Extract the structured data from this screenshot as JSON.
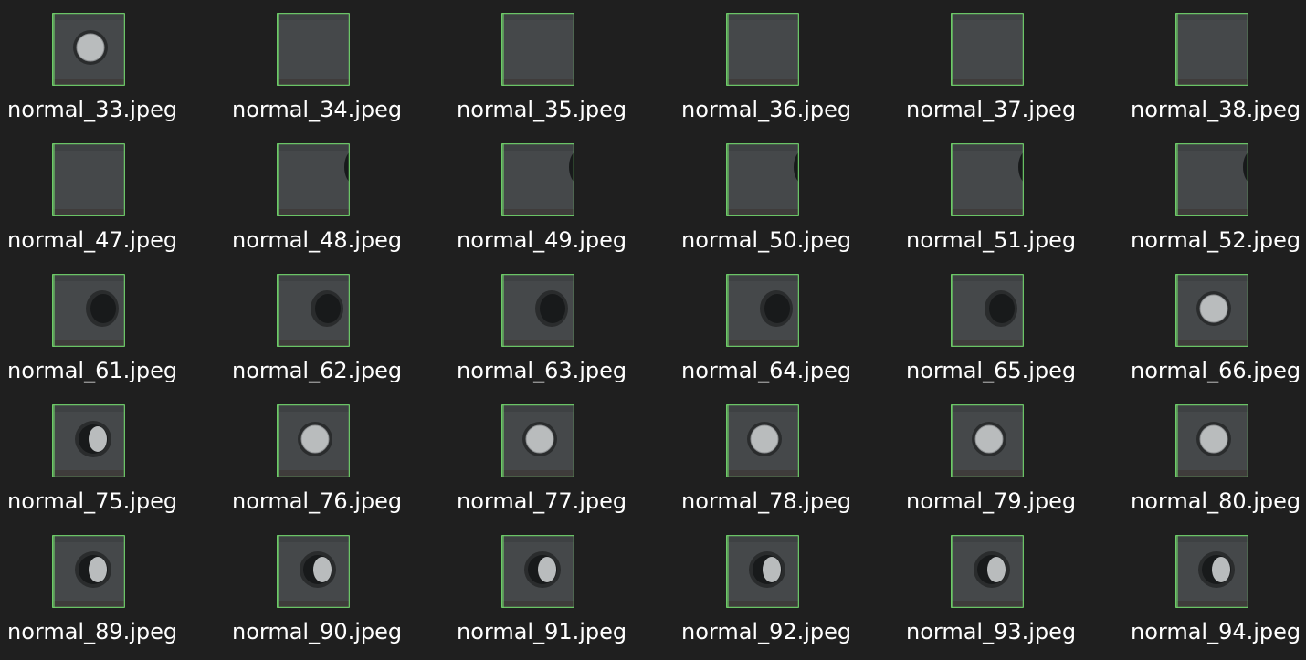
{
  "colors": {
    "background": "#1f1f1f",
    "label": "#ffffff",
    "thumb_border": "#6fd26a",
    "panel": "#45484a",
    "hole_dark": "#181a1b",
    "hole_light": "#b9bcbd"
  },
  "files": [
    {
      "name": "normal_33.jpeg",
      "icon": "image-file-icon",
      "hole": "light"
    },
    {
      "name": "normal_34.jpeg",
      "icon": "image-file-icon",
      "hole": "none"
    },
    {
      "name": "normal_35.jpeg",
      "icon": "image-file-icon",
      "hole": "none"
    },
    {
      "name": "normal_36.jpeg",
      "icon": "image-file-icon",
      "hole": "none"
    },
    {
      "name": "normal_37.jpeg",
      "icon": "image-file-icon",
      "hole": "none"
    },
    {
      "name": "normal_38.jpeg",
      "icon": "image-file-icon",
      "hole": "none"
    },
    {
      "name": "normal_47.jpeg",
      "icon": "image-file-icon",
      "hole": "none"
    },
    {
      "name": "normal_48.jpeg",
      "icon": "image-file-icon",
      "hole": "edge"
    },
    {
      "name": "normal_49.jpeg",
      "icon": "image-file-icon",
      "hole": "edge"
    },
    {
      "name": "normal_50.jpeg",
      "icon": "image-file-icon",
      "hole": "edge"
    },
    {
      "name": "normal_51.jpeg",
      "icon": "image-file-icon",
      "hole": "edge"
    },
    {
      "name": "normal_52.jpeg",
      "icon": "image-file-icon",
      "hole": "edge"
    },
    {
      "name": "normal_61.jpeg",
      "icon": "image-file-icon",
      "hole": "dark"
    },
    {
      "name": "normal_62.jpeg",
      "icon": "image-file-icon",
      "hole": "dark"
    },
    {
      "name": "normal_63.jpeg",
      "icon": "image-file-icon",
      "hole": "dark"
    },
    {
      "name": "normal_64.jpeg",
      "icon": "image-file-icon",
      "hole": "dark"
    },
    {
      "name": "normal_65.jpeg",
      "icon": "image-file-icon",
      "hole": "dark"
    },
    {
      "name": "normal_66.jpeg",
      "icon": "image-file-icon",
      "hole": "light"
    },
    {
      "name": "normal_75.jpeg",
      "icon": "image-file-icon",
      "hole": "half"
    },
    {
      "name": "normal_76.jpeg",
      "icon": "image-file-icon",
      "hole": "light"
    },
    {
      "name": "normal_77.jpeg",
      "icon": "image-file-icon",
      "hole": "light"
    },
    {
      "name": "normal_78.jpeg",
      "icon": "image-file-icon",
      "hole": "light"
    },
    {
      "name": "normal_79.jpeg",
      "icon": "image-file-icon",
      "hole": "light"
    },
    {
      "name": "normal_80.jpeg",
      "icon": "image-file-icon",
      "hole": "light"
    },
    {
      "name": "normal_89.jpeg",
      "icon": "image-file-icon",
      "hole": "half"
    },
    {
      "name": "normal_90.jpeg",
      "icon": "image-file-icon",
      "hole": "half"
    },
    {
      "name": "normal_91.jpeg",
      "icon": "image-file-icon",
      "hole": "half"
    },
    {
      "name": "normal_92.jpeg",
      "icon": "image-file-icon",
      "hole": "half"
    },
    {
      "name": "normal_93.jpeg",
      "icon": "image-file-icon",
      "hole": "half"
    },
    {
      "name": "normal_94.jpeg",
      "icon": "image-file-icon",
      "hole": "half"
    }
  ]
}
